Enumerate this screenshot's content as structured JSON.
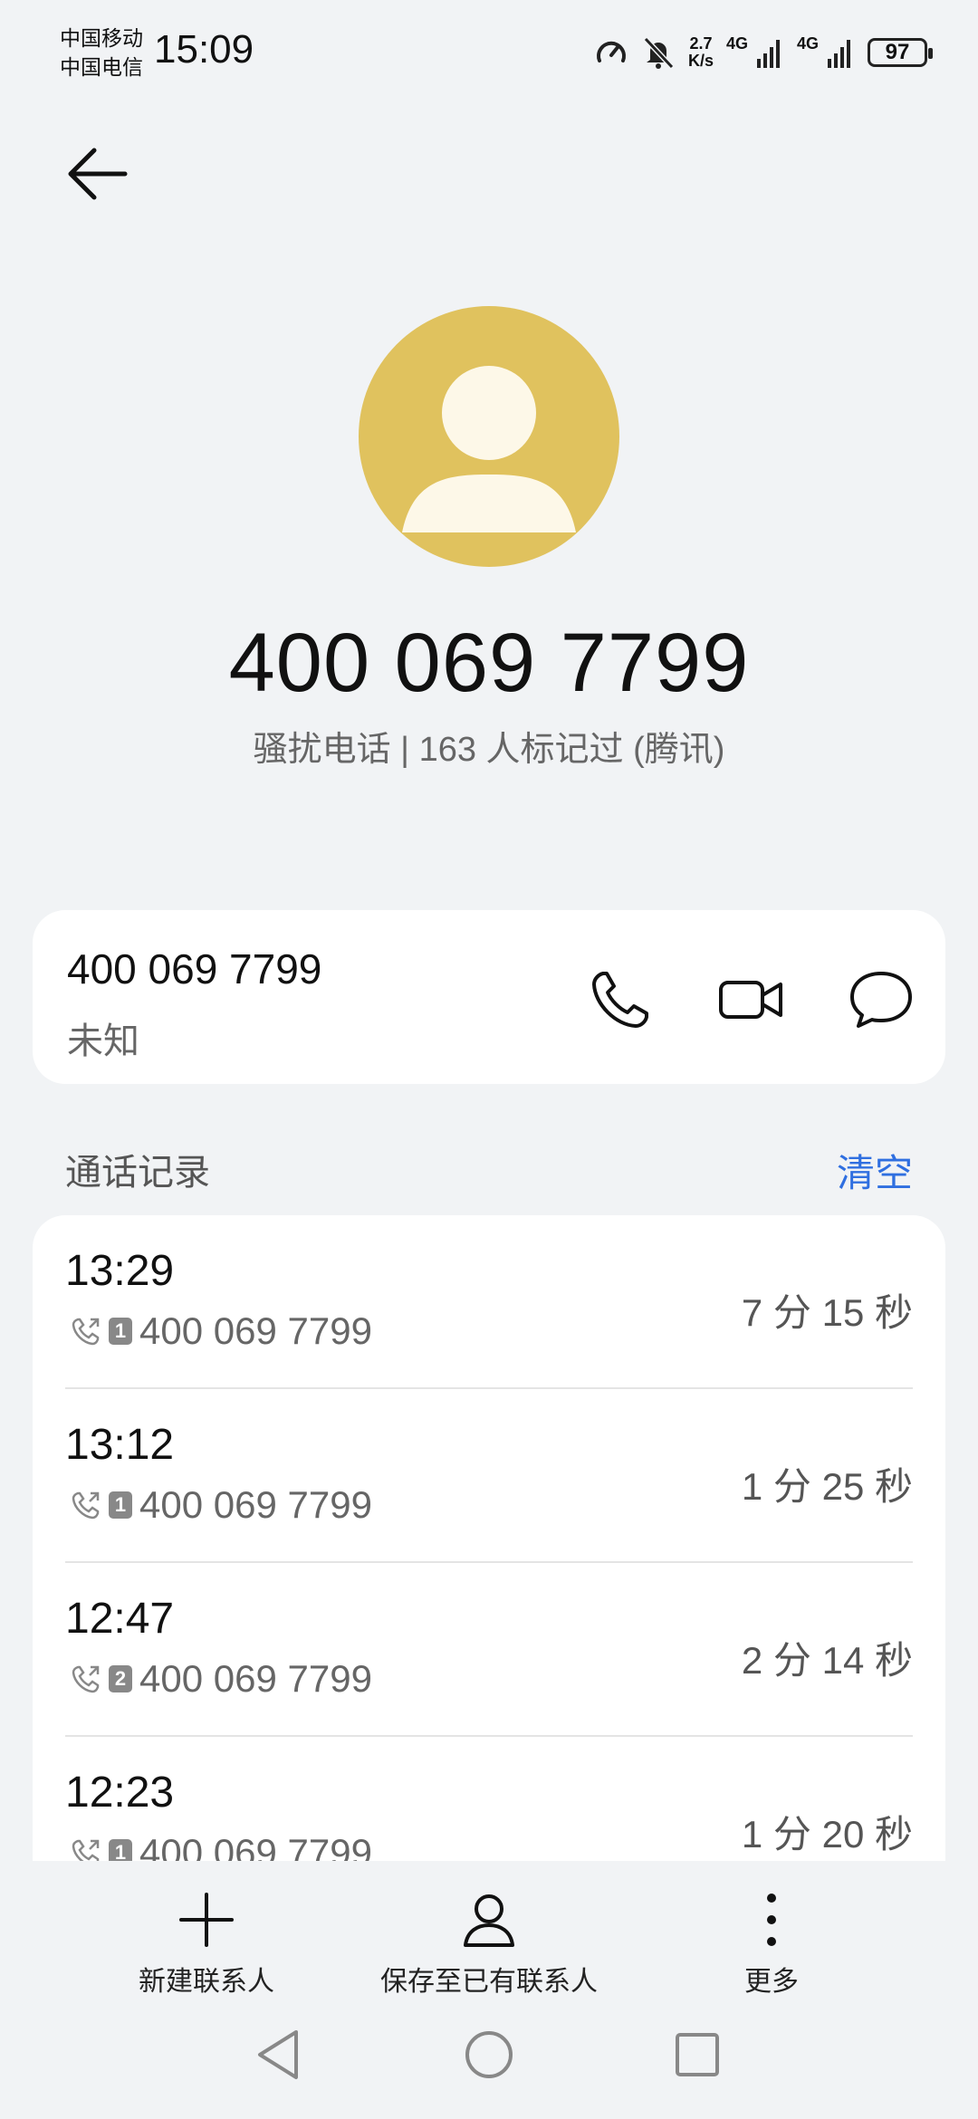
{
  "status_bar": {
    "carrier_1": "中国移动",
    "carrier_2": "中国电信",
    "time": "15:09",
    "net_speed_value": "2.7",
    "net_speed_unit": "K/s",
    "signal_1_label": "4G",
    "signal_2_label": "4G",
    "battery": "97"
  },
  "contact": {
    "number": "400 069 7799",
    "tag": "骚扰电话 | 163 人标记过 (腾讯)",
    "avatar_color": "#e0c25e"
  },
  "number_card": {
    "number": "400 069 7799",
    "location": "未知",
    "actions": [
      "phone-icon",
      "video-call-icon",
      "message-icon"
    ]
  },
  "call_log": {
    "title": "通话记录",
    "clear_label": "清空",
    "accent_color": "#2f6fe0",
    "entries": [
      {
        "time": "13:29",
        "sim": "1",
        "number": "400 069 7799",
        "duration": "7 分 15 秒"
      },
      {
        "time": "13:12",
        "sim": "1",
        "number": "400 069 7799",
        "duration": "1 分 25 秒"
      },
      {
        "time": "12:47",
        "sim": "2",
        "number": "400 069 7799",
        "duration": "2 分 14 秒"
      },
      {
        "time": "12:23",
        "sim": "1",
        "number": "400 069 7799",
        "duration": "1 分 20 秒"
      }
    ]
  },
  "toolbar": {
    "new_contact": "新建联系人",
    "save_existing": "保存至已有联系人",
    "more": "更多"
  }
}
